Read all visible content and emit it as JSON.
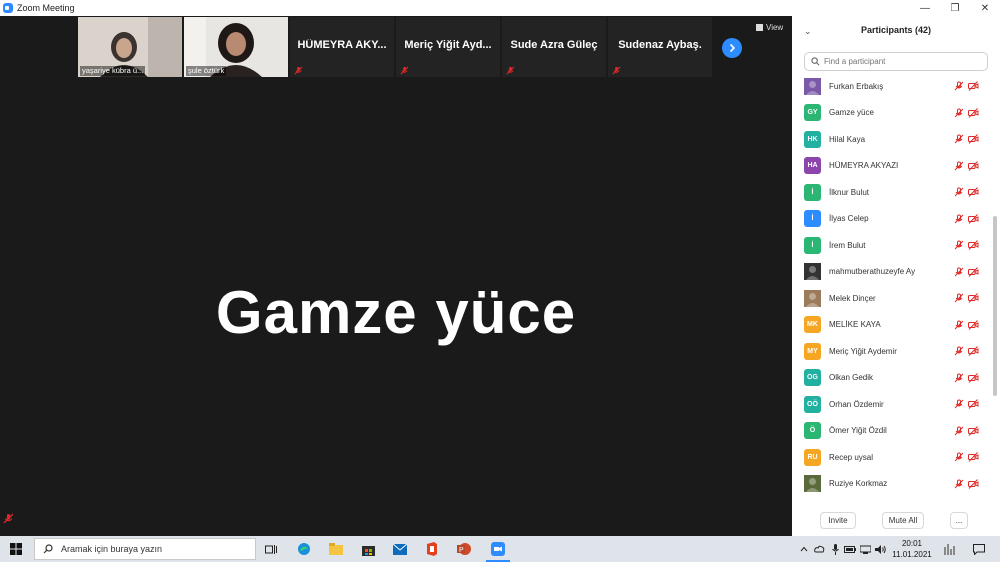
{
  "window": {
    "title": "Zoom Meeting"
  },
  "video_strip": {
    "tiles": [
      {
        "name": "yaşariye kübra ü...",
        "type": "video"
      },
      {
        "name": "şule öztürk",
        "type": "video"
      },
      {
        "name": "HÜMEYRA AKY...",
        "type": "name"
      },
      {
        "name": "Meriç Yiğit Ayd...",
        "type": "name"
      },
      {
        "name": "Sude Azra Güleç",
        "type": "name"
      },
      {
        "name": "Sudenaz Aybaş.",
        "type": "name"
      }
    ],
    "view_label": "View"
  },
  "active_speaker": {
    "name": "Gamze yüce"
  },
  "participants_panel": {
    "title": "Participants (42)",
    "search_placeholder": "Find a participant",
    "participants": [
      {
        "name": "Furkan Erbakış",
        "initials": "",
        "color": "#7a5aa8",
        "photo": true
      },
      {
        "name": "Gamze yüce",
        "initials": "GY",
        "color": "#2bb673"
      },
      {
        "name": "Hilal Kaya",
        "initials": "HK",
        "color": "#22b0a0"
      },
      {
        "name": "HÜMEYRA AKYAZI",
        "initials": "HA",
        "color": "#8e44ad"
      },
      {
        "name": "İlknur Bulut",
        "initials": "İ",
        "color": "#2bb673"
      },
      {
        "name": "İlyas Celep",
        "initials": "İ",
        "color": "#2d8cff"
      },
      {
        "name": "İrem Bulut",
        "initials": "İ",
        "color": "#2bb673"
      },
      {
        "name": "mahmutberathuzeyfe Ay",
        "initials": "",
        "color": "#333333",
        "photo": true
      },
      {
        "name": "Melek Dinçer",
        "initials": "",
        "color": "#9b7b5c",
        "photo": true
      },
      {
        "name": "MELİKE KAYA",
        "initials": "MK",
        "color": "#f5a623"
      },
      {
        "name": "Meriç Yiğit Aydemir",
        "initials": "MY",
        "color": "#f5a623"
      },
      {
        "name": "Olkan Gedik",
        "initials": "OG",
        "color": "#22b0a0"
      },
      {
        "name": "Orhan Özdemir",
        "initials": "OÖ",
        "color": "#22b0a0"
      },
      {
        "name": "Ömer Yiğit Özdil",
        "initials": "Ö",
        "color": "#2bb673"
      },
      {
        "name": "Recep uysal",
        "initials": "RU",
        "color": "#f5a623"
      },
      {
        "name": "Ruziye Korkmaz",
        "initials": "",
        "color": "#5a6a3a",
        "photo": true
      }
    ],
    "footer": {
      "invite": "Invite",
      "mute_all": "Mute All",
      "more": "..."
    }
  },
  "taskbar": {
    "search_placeholder": "Aramak için buraya yazın",
    "time": "20:01",
    "date": "11.01.2021"
  },
  "colors": {
    "zoom_blue": "#2d8cff",
    "mute_red": "#e02828",
    "meeting_bg": "#1a1a1a"
  }
}
